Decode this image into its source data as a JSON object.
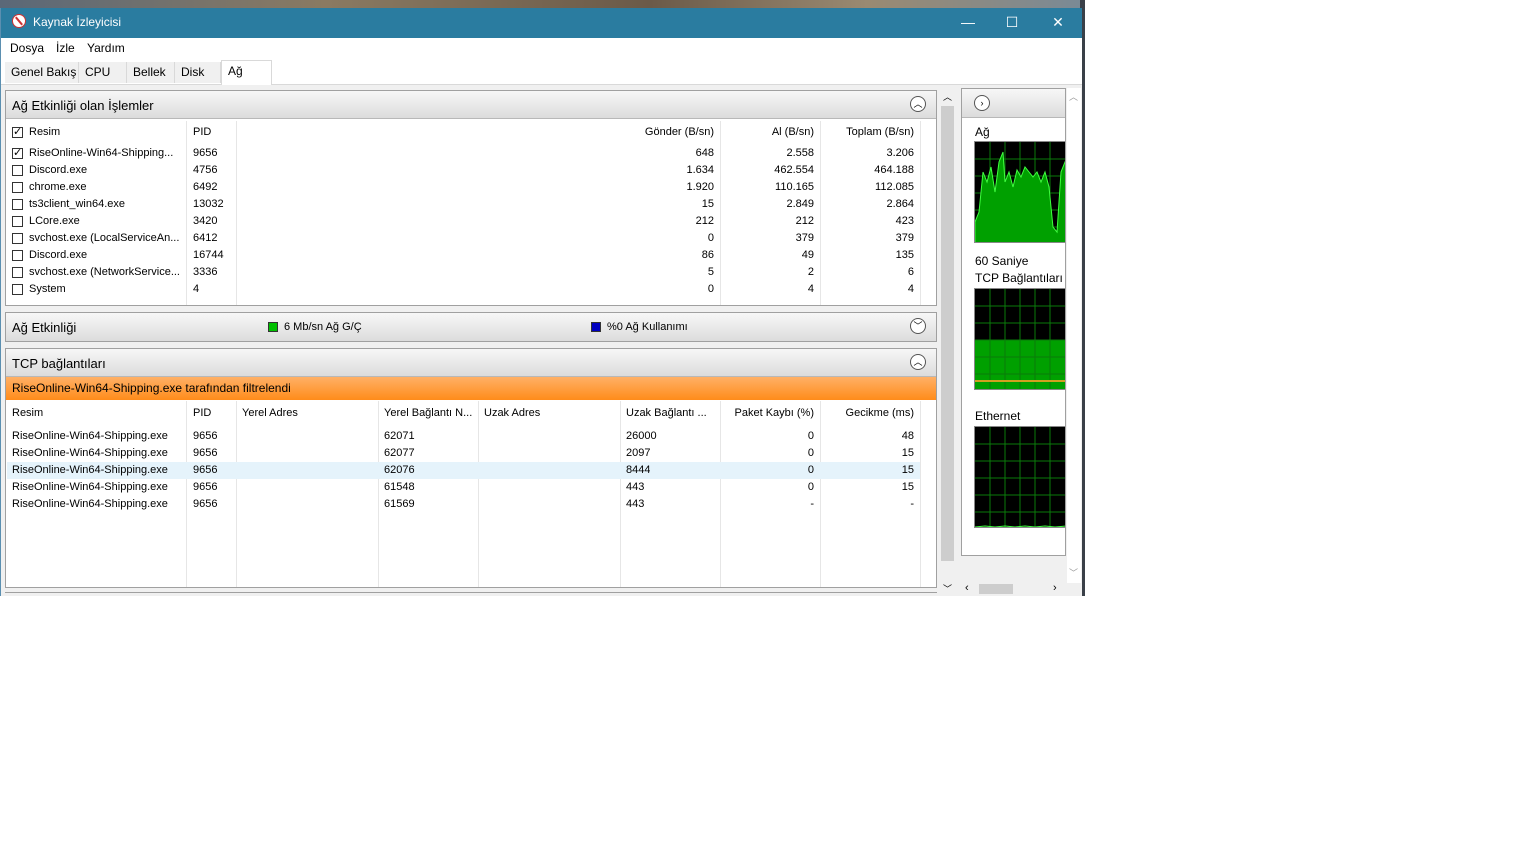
{
  "window": {
    "title": "Kaynak İzleyicisi",
    "minimize": "—",
    "maximize": "☐",
    "close": "✕"
  },
  "menu": [
    "Dosya",
    "İzle",
    "Yardım"
  ],
  "tabs": [
    "Genel Bakış",
    "CPU",
    "Bellek",
    "Disk",
    "Ağ"
  ],
  "processes": {
    "title": "Ağ Etkinliği olan İşlemler",
    "columns": [
      "Resim",
      "PID",
      "Gönder (B/sn)",
      "Al (B/sn)",
      "Toplam (B/sn)"
    ],
    "rows": [
      {
        "name": "RiseOnline-Win64-Shipping...",
        "pid": "9656",
        "send": "648",
        "recv": "2.558",
        "total": "3.206",
        "checked": true
      },
      {
        "name": "Discord.exe",
        "pid": "4756",
        "send": "1.634",
        "recv": "462.554",
        "total": "464.188",
        "checked": false
      },
      {
        "name": "chrome.exe",
        "pid": "6492",
        "send": "1.920",
        "recv": "110.165",
        "total": "112.085",
        "checked": false
      },
      {
        "name": "ts3client_win64.exe",
        "pid": "13032",
        "send": "15",
        "recv": "2.849",
        "total": "2.864",
        "checked": false
      },
      {
        "name": "LCore.exe",
        "pid": "3420",
        "send": "212",
        "recv": "212",
        "total": "423",
        "checked": false
      },
      {
        "name": "svchost.exe (LocalServiceAn...",
        "pid": "6412",
        "send": "0",
        "recv": "379",
        "total": "379",
        "checked": false
      },
      {
        "name": "Discord.exe",
        "pid": "16744",
        "send": "86",
        "recv": "49",
        "total": "135",
        "checked": false
      },
      {
        "name": "svchost.exe (NetworkService...",
        "pid": "3336",
        "send": "5",
        "recv": "2",
        "total": "6",
        "checked": false
      },
      {
        "name": "System",
        "pid": "4",
        "send": "0",
        "recv": "4",
        "total": "4",
        "checked": false
      }
    ]
  },
  "activity": {
    "title": "Ağ Etkinliği",
    "io": "6 Mb/sn Ağ G/Ç",
    "usage": "%0 Ağ Kullanımı",
    "io_color": "#00c000",
    "usage_color": "#0000c0"
  },
  "tcp": {
    "title": "TCP bağlantıları",
    "filter": "RiseOnline-Win64-Shipping.exe tarafından filtrelendi",
    "columns": [
      "Resim",
      "PID",
      "Yerel Adres",
      "Yerel Bağlantı N...",
      "Uzak Adres",
      "Uzak Bağlantı ...",
      "Paket Kaybı (%)",
      "Gecikme (ms)"
    ],
    "rows": [
      {
        "name": "RiseOnline-Win64-Shipping.exe",
        "pid": "9656",
        "lport": "62071",
        "rport": "26000",
        "loss": "0",
        "latency": "48"
      },
      {
        "name": "RiseOnline-Win64-Shipping.exe",
        "pid": "9656",
        "lport": "62077",
        "rport": "2097",
        "loss": "0",
        "latency": "15"
      },
      {
        "name": "RiseOnline-Win64-Shipping.exe",
        "pid": "9656",
        "lport": "62076",
        "rport": "8444",
        "loss": "0",
        "latency": "15"
      },
      {
        "name": "RiseOnline-Win64-Shipping.exe",
        "pid": "9656",
        "lport": "61548",
        "rport": "443",
        "loss": "0",
        "latency": "15"
      },
      {
        "name": "RiseOnline-Win64-Shipping.exe",
        "pid": "9656",
        "lport": "61569",
        "rport": "443",
        "loss": "-",
        "latency": "-"
      }
    ]
  },
  "side": {
    "net": "Ağ",
    "seconds": "60 Saniye",
    "tcp": "TCP Bağlantıları",
    "ethernet": "Ethernet"
  }
}
